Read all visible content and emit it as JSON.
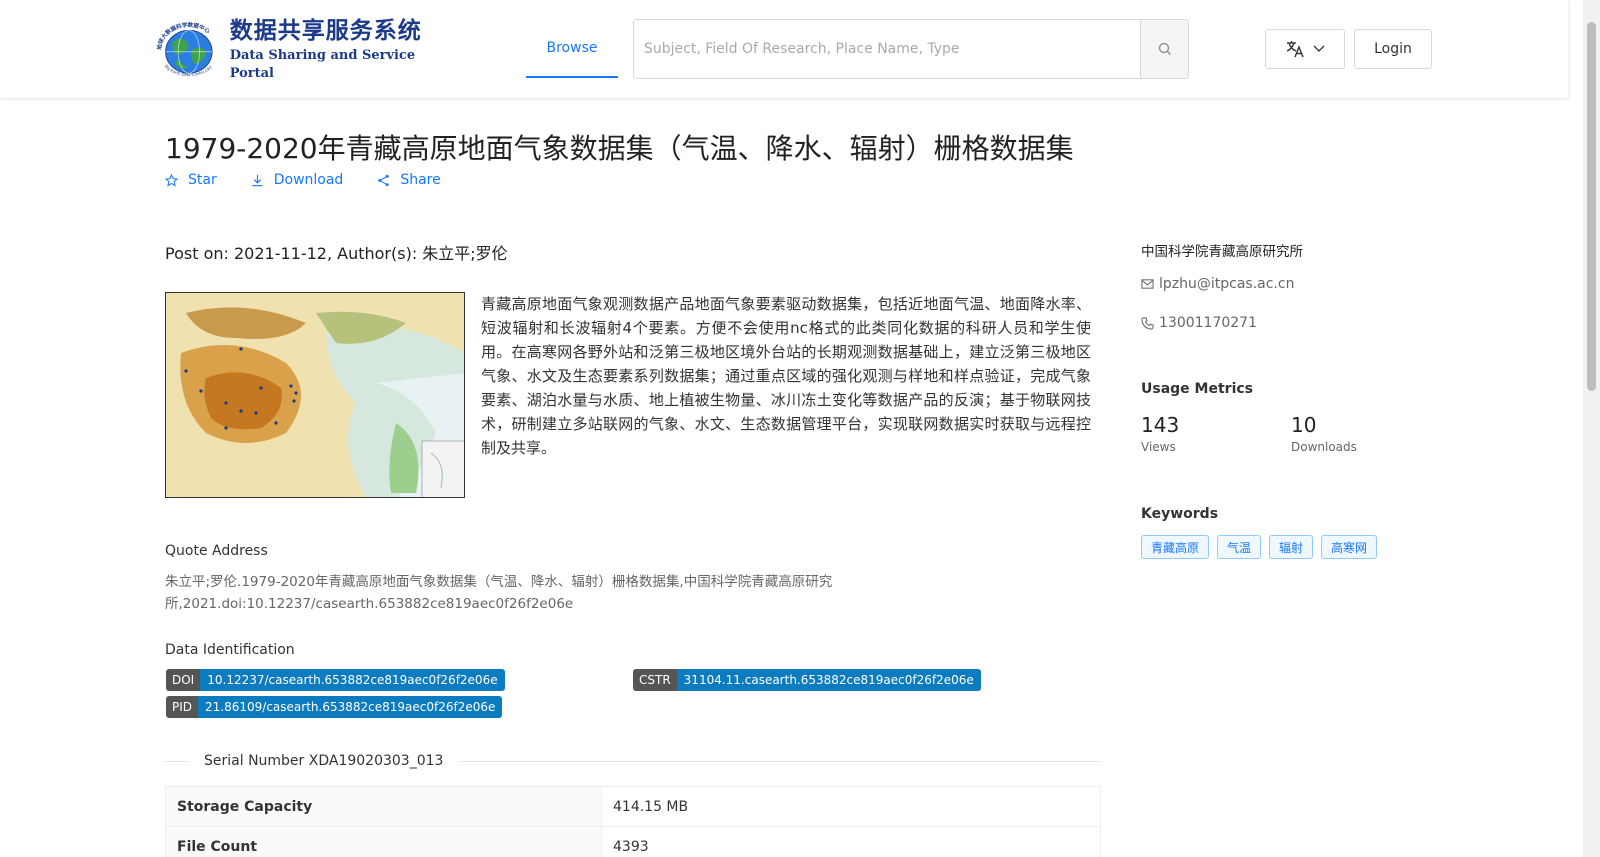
{
  "header": {
    "logo": {
      "cn": "数据共享服务系统",
      "en": "Data Sharing and Service Portal",
      "ring_text": "地球大数据科学数据中心",
      "sub_text": "Big Earth Data Center,CAS"
    },
    "nav": {
      "browse": "Browse"
    },
    "search": {
      "placeholder": "Subject, Field Of Research, Place Name, Type",
      "icon": "search-icon"
    },
    "lang_icon": "translate-icon",
    "login": "Login"
  },
  "dataset": {
    "title": "1979-2020年青藏高原地面气象数据集（气温、降水、辐射）栅格数据集",
    "actions": {
      "star": "Star",
      "download": "Download",
      "share": "Share"
    },
    "meta": "Post on: 2021-11-12, Author(s): 朱立平;罗伦",
    "description": "青藏高原地面气象观测数据产品地面气象要素驱动数据集，包括近地面气温、地面降水率、短波辐射和长波辐射4个要素。方便不会使用nc格式的此类同化数据的科研人员和学生使用。在高寒网各野外站和泛第三极地区境外台站的长期观测数据基础上，建立泛第三极地区气象、水文及生态要素系列数据集；通过重点区域的强化观测与样地和样点验证，完成气象要素、湖泊水量与水质、地上植被生物量、冰川冻土变化等数据产品的反演；基于物联网技术，研制建立多站联网的气象、水文、生态数据管理平台，实现联网数据实时获取与远程控制及共享。",
    "quote": {
      "label": "Quote Address",
      "text": "朱立平;罗伦.1979-2020年青藏高原地面气象数据集（气温、降水、辐射）栅格数据集,中国科学院青藏高原研究所,2021.doi:10.12237/casearth.653882ce819aec0f26f2e06e"
    },
    "identification": {
      "label": "Data Identification",
      "doi": {
        "key": "DOI",
        "value": "10.12237/casearth.653882ce819aec0f26f2e06e"
      },
      "cstr": {
        "key": "CSTR",
        "value": "31104.11.casearth.653882ce819aec0f26f2e06e"
      },
      "pid": {
        "key": "PID",
        "value": "21.86109/casearth.653882ce819aec0f26f2e06e"
      }
    },
    "serial": "Serial Number XDA19020303_013",
    "table": [
      {
        "label": "Storage Capacity",
        "value": "414.15 MB"
      },
      {
        "label": "File Count",
        "value": "4393"
      }
    ]
  },
  "sidebar": {
    "org": "中国科学院青藏高原研究所",
    "email": "lpzhu@itpcas.ac.cn",
    "phone": "13001170271",
    "usage": {
      "title": "Usage Metrics",
      "views": {
        "value": "143",
        "label": "Views"
      },
      "downloads": {
        "value": "10",
        "label": "Downloads"
      }
    },
    "keywords": {
      "title": "Keywords",
      "items": [
        "青藏高原",
        "气温",
        "辐射",
        "高寒网"
      ]
    }
  },
  "colors": {
    "accent": "#1677ff",
    "badge_key": "#555555",
    "badge_value": "#0d7bbf",
    "logo_blue": "#1b3a8a"
  }
}
